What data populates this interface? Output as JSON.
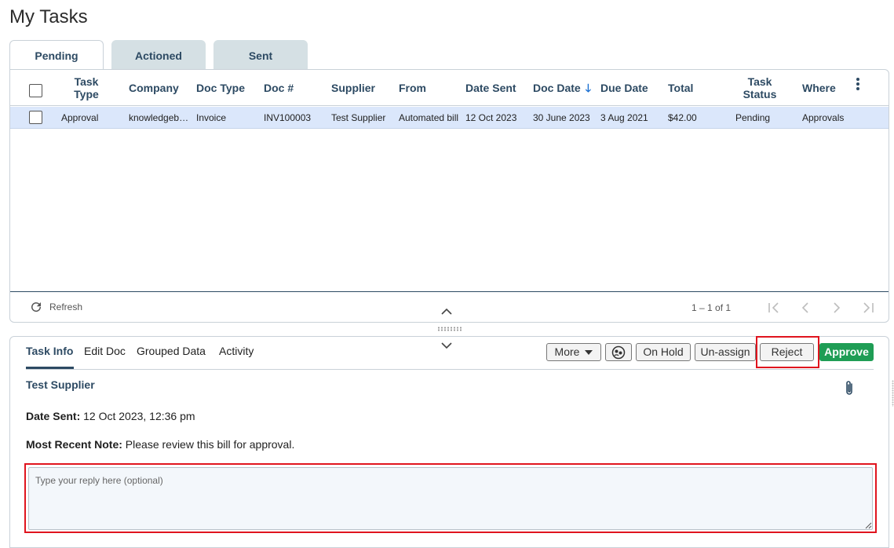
{
  "page": {
    "title": "My Tasks"
  },
  "tabs": [
    {
      "label": "Pending",
      "active": true
    },
    {
      "label": "Actioned",
      "active": false
    },
    {
      "label": "Sent",
      "active": false
    }
  ],
  "grid": {
    "columns": {
      "task_type": "Task Type",
      "company": "Company",
      "doc_type": "Doc Type",
      "doc_num": "Doc #",
      "supplier": "Supplier",
      "from": "From",
      "date_sent": "Date Sent",
      "doc_date": "Doc Date",
      "due_date": "Due Date",
      "total": "Total",
      "task_status": "Task Status",
      "where": "Where"
    },
    "sorted_column": "doc_date",
    "sort_direction": "descending",
    "rows": [
      {
        "task_type": "Approval",
        "company": "knowledgebase",
        "doc_type": "Invoice",
        "doc_num": "INV100003",
        "supplier": "Test Supplier",
        "from": "Automated bill",
        "date_sent": "12 Oct 2023",
        "doc_date": "30 June 2023",
        "due_date": "3 Aug 2021",
        "total": "$42.00",
        "task_status": "Pending",
        "where": "Approvals",
        "selected": true
      }
    ]
  },
  "footer": {
    "refresh_label": "Refresh",
    "paging_text": "1 – 1 of 1"
  },
  "detail": {
    "tabs": [
      "Task Info",
      "Edit Doc",
      "Grouped Data",
      "Activity"
    ],
    "actions": {
      "more": "More",
      "on_hold": "On Hold",
      "unassign": "Un-assign",
      "reject": "Reject",
      "approve": "Approve"
    },
    "supplier_name": "Test Supplier",
    "date_sent_label": "Date Sent:",
    "date_sent_value": "12 Oct 2023, 12:36 pm",
    "note_label": "Most Recent Note:",
    "note_value": "Please review this bill for approval.",
    "reply_placeholder": "Type your reply here (optional)"
  },
  "colors": {
    "accent": "#2d4a63",
    "approve": "#1f9d55",
    "highlight": "#e0141e",
    "selected_row": "#dbe7fb"
  }
}
